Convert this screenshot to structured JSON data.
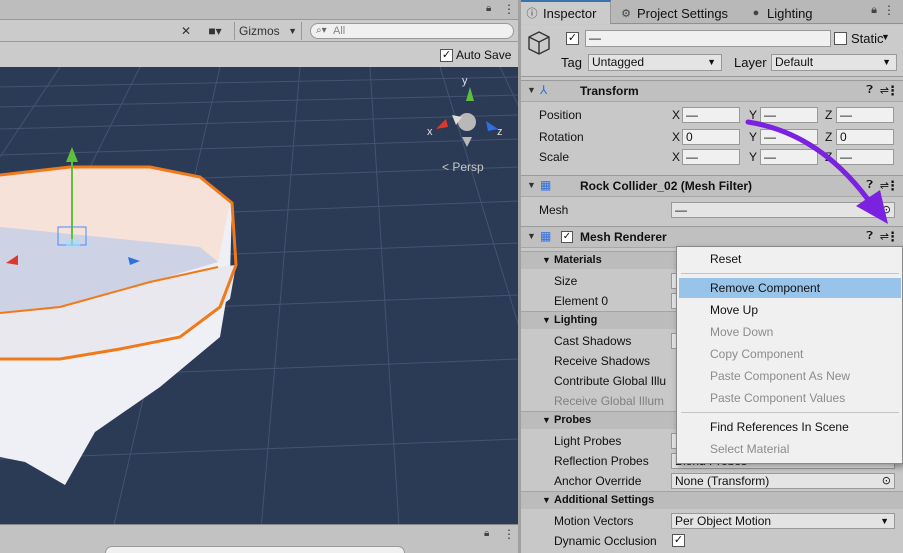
{
  "scene": {
    "toolbar": {
      "gizmos_label": "Gizmos",
      "search_placeholder": "All"
    },
    "autosave_label": "Auto Save",
    "autosave_checked": "✓",
    "persp_label": "Persp",
    "axis_labels": {
      "x": "x",
      "y": "y",
      "z": "z"
    }
  },
  "inspector": {
    "tabs": [
      {
        "label": "Inspector",
        "icon": "info-icon"
      },
      {
        "label": "Project Settings",
        "icon": "gear-icon"
      },
      {
        "label": "Lighting",
        "icon": "bulb-icon"
      }
    ],
    "header": {
      "active_check": "✓",
      "name_value": "—",
      "static_label": "Static",
      "tag_label": "Tag",
      "tag_value": "Untagged",
      "layer_label": "Layer",
      "layer_value": "Default"
    },
    "transform": {
      "title": "Transform",
      "rows": [
        {
          "label": "Position",
          "x": "—",
          "y": "—",
          "z": "—"
        },
        {
          "label": "Rotation",
          "x": "0",
          "y": "—",
          "z": "0"
        },
        {
          "label": "Scale",
          "x": "—",
          "y": "—",
          "z": "—"
        }
      ],
      "axis_x": "X",
      "axis_y": "Y",
      "axis_z": "Z"
    },
    "mesh_filter": {
      "title": "Rock Collider_02 (Mesh Filter)",
      "mesh_label": "Mesh",
      "mesh_value": "—"
    },
    "mesh_renderer": {
      "title": "Mesh Renderer",
      "enabled_check": "✓",
      "sections": {
        "materials": "Materials",
        "lighting": "Lighting",
        "probes": "Probes",
        "additional": "Additional Settings"
      },
      "props": {
        "size": "Size",
        "element0": "Element 0",
        "cast_shadows": "Cast Shadows",
        "receive_shadows": "Receive Shadows",
        "contribute_gi": "Contribute Global Illu",
        "receive_gi": "Receive Global Illum",
        "light_probes": "Light Probes",
        "reflection_probes": "Reflection Probes",
        "reflection_value": "Blend Probes",
        "anchor_override": "Anchor Override",
        "anchor_value": "None (Transform)",
        "motion_vectors": "Motion Vectors",
        "motion_value": "Per Object Motion",
        "dynamic_occlusion": "Dynamic Occlusion",
        "dynamic_check": "✓"
      }
    }
  },
  "context_menu": {
    "items": [
      {
        "label": "Reset",
        "enabled": true
      },
      {
        "label": "Remove Component",
        "enabled": true,
        "highlighted": true
      },
      {
        "label": "Move Up",
        "enabled": true
      },
      {
        "label": "Move Down",
        "enabled": false
      },
      {
        "label": "Copy Component",
        "enabled": false
      },
      {
        "label": "Paste Component As New",
        "enabled": false
      },
      {
        "label": "Paste Component Values",
        "enabled": false
      },
      {
        "label": "Find References In Scene",
        "enabled": true
      },
      {
        "label": "Select Material",
        "enabled": false
      }
    ]
  },
  "colors": {
    "viewport_bg": "#2b3a55",
    "selection_outline": "#f07a1a",
    "menu_highlight": "#98c4ea",
    "annotation_arrow": "#7a22e0"
  }
}
